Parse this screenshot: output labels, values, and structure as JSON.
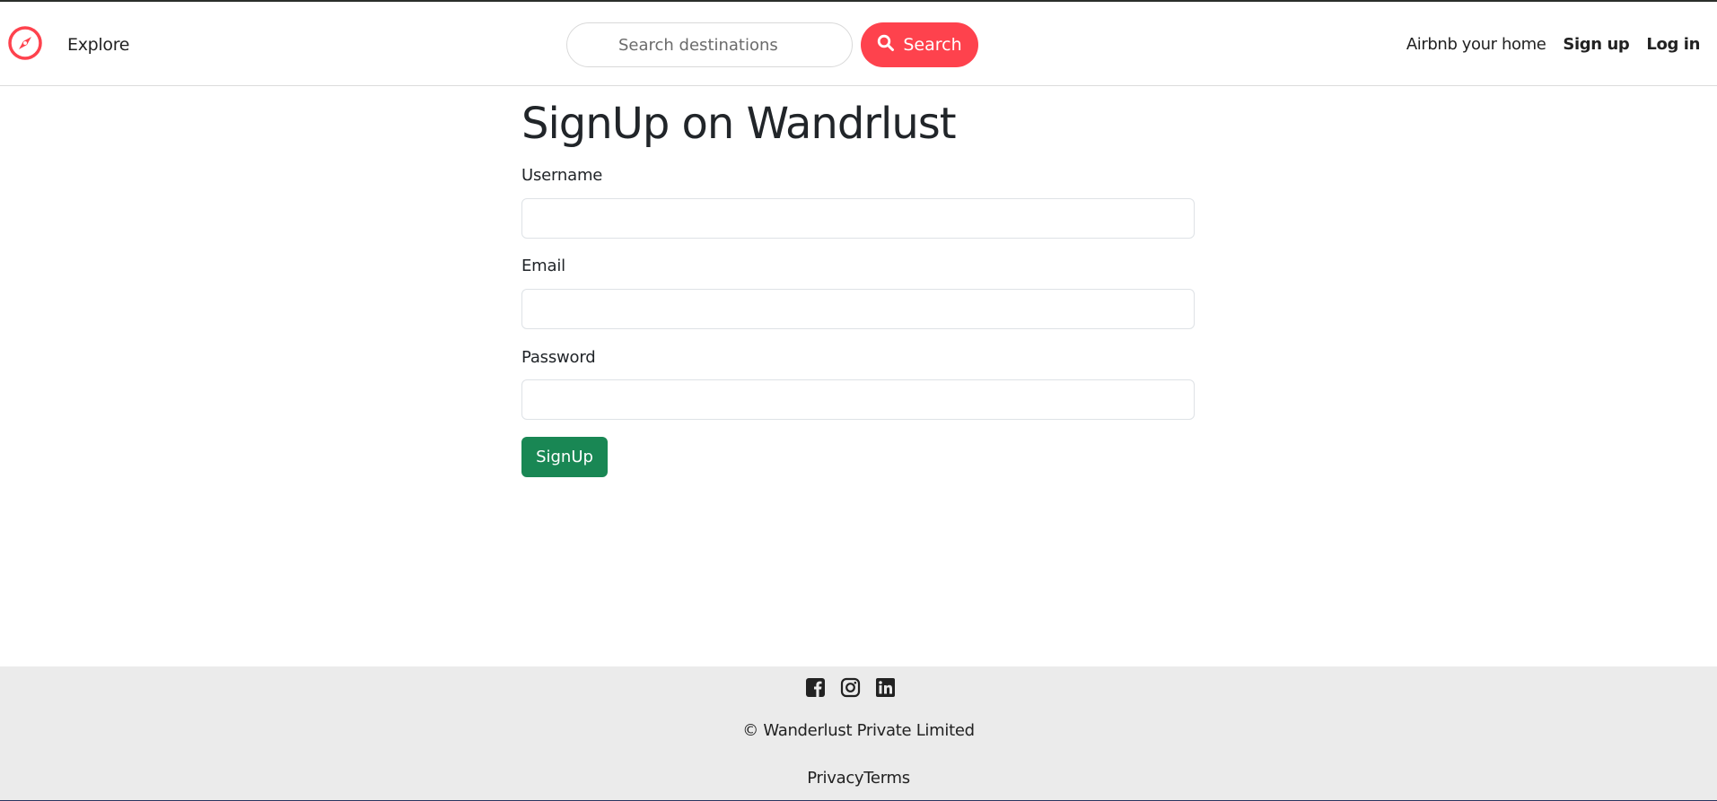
{
  "navbar": {
    "logo_icon": "compass-icon",
    "brand_color": "#fe424d",
    "explore_label": "Explore",
    "search": {
      "placeholder": "Search destinations",
      "button_label": "Search",
      "button_icon": "search-icon"
    },
    "host_label": "Airbnb your home",
    "signup_label": "Sign up",
    "login_label": "Log in"
  },
  "main": {
    "title": "SignUp on Wandrlust",
    "fields": {
      "username_label": "Username",
      "email_label": "Email",
      "password_label": "Password"
    },
    "submit_label": "SignUp",
    "submit_color": "#198754"
  },
  "footer": {
    "social_icons": [
      "facebook-icon",
      "instagram-icon",
      "linkedin-icon"
    ],
    "copyright": "© Wanderlust Private Limited",
    "links": [
      "Privacy",
      "Terms"
    ]
  }
}
